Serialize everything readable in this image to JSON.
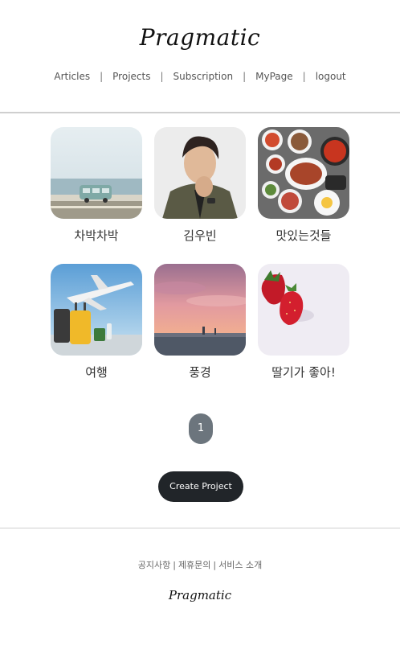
{
  "header": {
    "brand": "Pragmatic",
    "nav": [
      {
        "label": "Articles"
      },
      {
        "label": "Projects"
      },
      {
        "label": "Subscription"
      },
      {
        "label": "MyPage"
      },
      {
        "label": "logout"
      }
    ],
    "separator": "|"
  },
  "projects": [
    {
      "title": "차박차박",
      "image": "van-by-sea-photo"
    },
    {
      "title": "김우빈",
      "image": "portrait-photo"
    },
    {
      "title": "맛있는것들",
      "image": "korean-food-table-photo"
    },
    {
      "title": "여행",
      "image": "airplane-luggage-photo"
    },
    {
      "title": "풍경",
      "image": "sunset-sky-photo"
    },
    {
      "title": "딸기가 좋아!",
      "image": "strawberries-photo"
    }
  ],
  "pagination": {
    "current": "1"
  },
  "actions": {
    "create_label": "Create Project"
  },
  "footer": {
    "links": [
      {
        "label": "공지사항"
      },
      {
        "label": "제휴문의"
      },
      {
        "label": "서비스 소개"
      }
    ],
    "separator": "|",
    "brand": "Pragmatic"
  },
  "colors": {
    "pager": "#6c757d",
    "button": "#212529",
    "divider": "#cfcfcf"
  }
}
